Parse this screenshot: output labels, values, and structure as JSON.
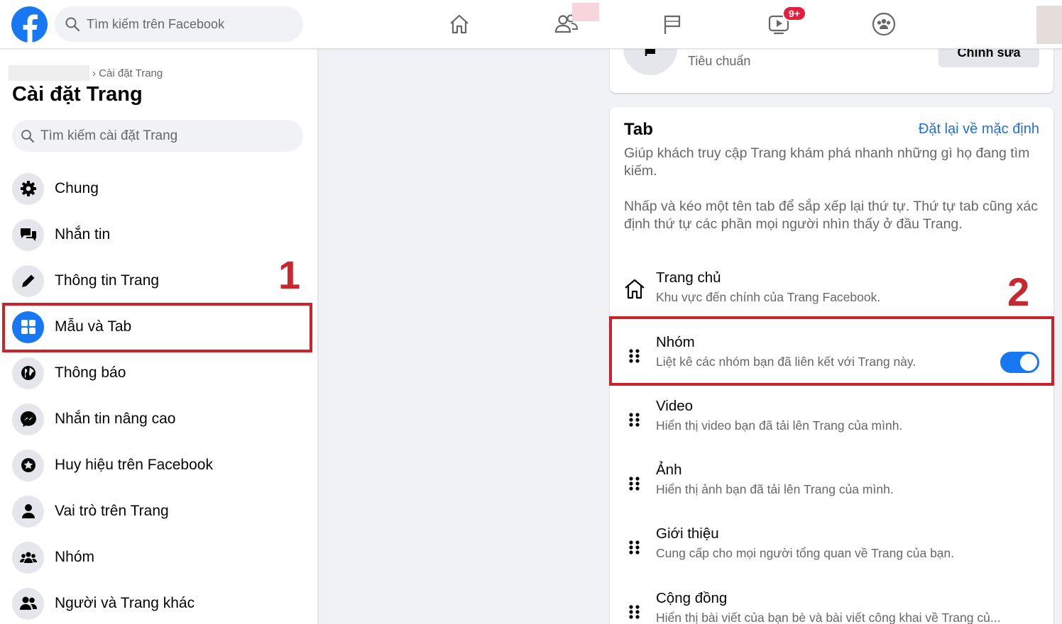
{
  "topbar": {
    "search_placeholder": "Tìm kiếm trên Facebook",
    "notification_badge": "9+"
  },
  "sidebar": {
    "breadcrumb": "Cài đặt Trang",
    "title": "Cài đặt Trang",
    "search_placeholder": "Tìm kiếm cài đặt Trang",
    "items": [
      {
        "label": "Chung",
        "icon": "gear-icon"
      },
      {
        "label": "Nhắn tin",
        "icon": "chat-bubbles-icon"
      },
      {
        "label": "Thông tin Trang",
        "icon": "pencil-icon"
      },
      {
        "label": "Mẫu và Tab",
        "icon": "grid-icon",
        "active": true
      },
      {
        "label": "Thông báo",
        "icon": "globe-icon"
      },
      {
        "label": "Nhắn tin nâng cao",
        "icon": "messenger-icon"
      },
      {
        "label": "Huy hiệu trên Facebook",
        "icon": "star-badge-icon"
      },
      {
        "label": "Vai trò trên Trang",
        "icon": "person-icon"
      },
      {
        "label": "Nhóm",
        "icon": "group-icon"
      },
      {
        "label": "Người và Trang khác",
        "icon": "people-icon"
      }
    ]
  },
  "template_card": {
    "subtitle": "Tiêu chuẩn",
    "edit_label": "Chỉnh sửa"
  },
  "tabs_card": {
    "title": "Tab",
    "reset_label": "Đặt lại về mặc định",
    "description": "Giúp khách truy cập Trang khám phá nhanh những gì họ đang tìm kiếm.",
    "instruction": "Nhấp và kéo một tên tab để sắp xếp lại thứ tự. Thứ tự tab cũng xác định thứ tự các phần mọi người nhìn thấy ở đầu Trang.",
    "tabs": [
      {
        "name": "Trang chủ",
        "desc": "Khu vực đến chính của Trang Facebook."
      },
      {
        "name": "Nhóm",
        "desc": "Liệt kê các nhóm bạn đã liên kết với Trang này.",
        "enabled": true
      },
      {
        "name": "Video",
        "desc": "Hiển thị video bạn đã tải lên Trang của mình."
      },
      {
        "name": "Ảnh",
        "desc": "Hiển thị ảnh bạn đã tải lên Trang của mình."
      },
      {
        "name": "Giới thiệu",
        "desc": "Cung cấp cho mọi người tổng quan về Trang của bạn."
      },
      {
        "name": "Cộng đồng",
        "desc": "Hiển thị bài viết của bạn bè và bài viết công khai về Trang củ..."
      }
    ]
  },
  "annotations": {
    "step1": "1",
    "step2": "2",
    "color": "#cc2229"
  },
  "colors": {
    "brand": "#1877f2",
    "link": "#216fdb"
  }
}
